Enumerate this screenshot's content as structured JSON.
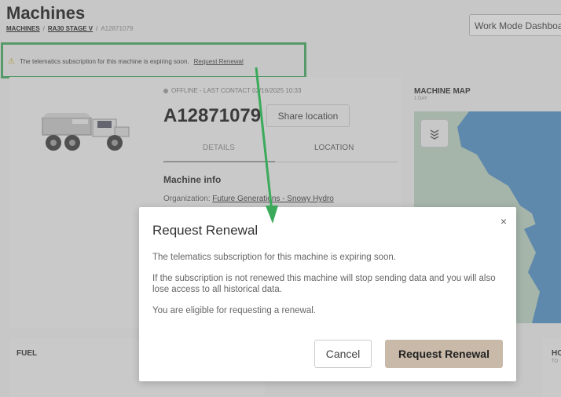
{
  "header": {
    "title": "Machines",
    "breadcrumb": [
      "MACHINES",
      "RA30 STAGE V",
      "A12871079"
    ],
    "mode_select": "Work Mode Dashboard"
  },
  "alert": {
    "icon": "warning-icon",
    "text": "The telematics subscription for this machine is expiring soon.",
    "link": "Request Renewal"
  },
  "machine": {
    "status": "OFFLINE - LAST CONTACT 02/16/2025 10:33",
    "id": "A12871079",
    "share_label": "Share location",
    "tabs": [
      "DETAILS",
      "LOCATION"
    ],
    "info_title": "Machine info",
    "org_label": "Organization:",
    "org_value": "Future Generations - Snowy Hydro"
  },
  "map": {
    "title": "MACHINE MAP",
    "subtitle": "1 DAY"
  },
  "cards": {
    "fuel": "FUEL",
    "right_label": "HO",
    "right_sub": "TO"
  },
  "modal": {
    "title": "Request Renewal",
    "paragraphs": [
      "The telematics subscription for this machine is expiring soon.",
      "If the subscription is not renewed this machine will stop sending data and you will also lose access to all historical data.",
      "You are eligible for requesting a renewal."
    ],
    "close": "×",
    "cancel": "Cancel",
    "confirm": "Request Renewal"
  },
  "colors": {
    "highlight": "#3aaa5a",
    "primary_button": "#c8b9a9"
  }
}
